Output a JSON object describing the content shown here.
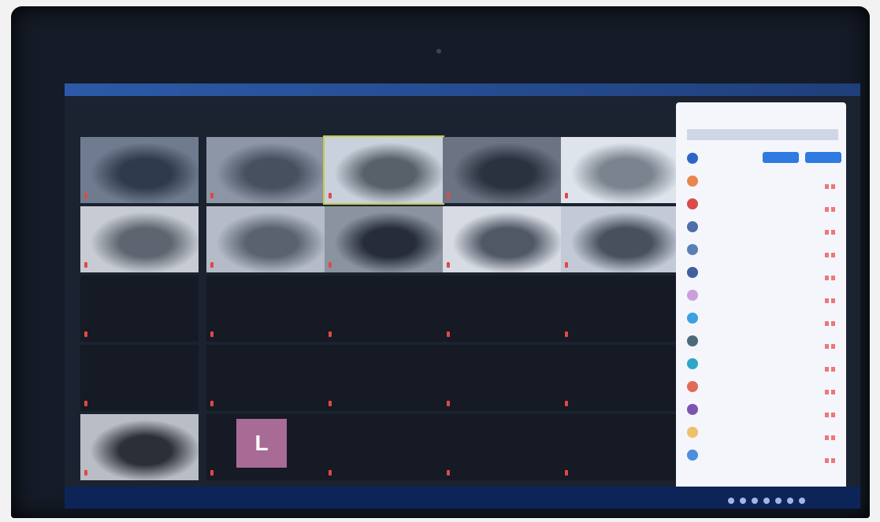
{
  "grid": {
    "tiles": [
      {
        "type": "video",
        "name": "",
        "colors": [
          "#6f7c8f",
          "#2f3a4c"
        ]
      },
      {
        "type": "video",
        "name": "",
        "colors": [
          "#8d96a6",
          "#46505f"
        ]
      },
      {
        "type": "video",
        "name": "",
        "colors": [
          "#c9d1dc",
          "#58606a"
        ],
        "active": true
      },
      {
        "type": "video",
        "name": "",
        "colors": [
          "#6c7483",
          "#2a323f"
        ]
      },
      {
        "type": "video",
        "name": "",
        "colors": [
          "#dfe4ec",
          "#7a838e"
        ]
      },
      {
        "type": "video",
        "name": "",
        "colors": [
          "#c7ccd4",
          "#5f6570"
        ]
      },
      {
        "type": "video",
        "name": "",
        "colors": [
          "#b5bcc7",
          "#5a6270"
        ]
      },
      {
        "type": "video",
        "name": "",
        "colors": [
          "#8b93a0",
          "#262d38"
        ]
      },
      {
        "type": "video",
        "name": "",
        "colors": [
          "#d7dbe3",
          "#505866"
        ]
      },
      {
        "type": "video",
        "name": "",
        "colors": [
          "#c3cad6",
          "#48505e"
        ]
      },
      {
        "type": "name",
        "name": ""
      },
      {
        "type": "name",
        "name": ""
      },
      {
        "type": "name",
        "name": ""
      },
      {
        "type": "name",
        "name": ""
      },
      {
        "type": "name",
        "name": ""
      },
      {
        "type": "name",
        "name": ""
      },
      {
        "type": "name",
        "name": ""
      },
      {
        "type": "name",
        "name": ""
      },
      {
        "type": "name",
        "name": ""
      },
      {
        "type": "name",
        "name": ""
      },
      {
        "type": "video",
        "name": "",
        "colors": [
          "#b9bec6",
          "#2b2f38"
        ]
      },
      {
        "type": "avatar",
        "letter": "L",
        "name": ""
      },
      {
        "type": "name",
        "name": ""
      },
      {
        "type": "name",
        "name": ""
      },
      {
        "type": "name",
        "name": ""
      }
    ]
  },
  "participants_panel": {
    "title": "",
    "subtitle": "",
    "rows": [
      {
        "color": "#2f64c7",
        "name": "",
        "buttons": [
          "",
          ""
        ]
      },
      {
        "color": "#e8864d",
        "name": ""
      },
      {
        "color": "#d94a4a",
        "name": ""
      },
      {
        "color": "#4d6ea8",
        "name": ""
      },
      {
        "color": "#5a7fb8",
        "name": ""
      },
      {
        "color": "#3f5f9f",
        "name": ""
      },
      {
        "color": "#c9a0d8",
        "name": ""
      },
      {
        "color": "#3ea0df",
        "name": ""
      },
      {
        "color": "#4b6b7a",
        "name": ""
      },
      {
        "color": "#2fa6c8",
        "name": ""
      },
      {
        "color": "#e06b55",
        "name": ""
      },
      {
        "color": "#7a55b0",
        "name": ""
      },
      {
        "color": "#f0c06a",
        "name": ""
      },
      {
        "color": "#4b8fe0",
        "name": ""
      }
    ],
    "footer_left": "",
    "footer_right": ""
  },
  "taskbar": {
    "clock_time": "",
    "clock_date": "",
    "tray_icons": [
      "wifi-icon",
      "volume-icon",
      "battery-icon",
      "notification-icon",
      "lang-icon",
      "cloud-icon",
      "shield-icon"
    ]
  }
}
